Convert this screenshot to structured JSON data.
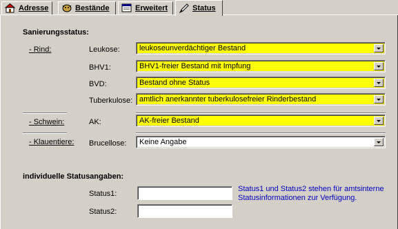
{
  "tabs": [
    {
      "label": "Adresse",
      "icon": "house-icon"
    },
    {
      "label": "Bestände",
      "icon": "cow-icon"
    },
    {
      "label": "Erweitert",
      "icon": "window-icon"
    },
    {
      "label": "Status",
      "icon": "pen-icon",
      "active": true
    }
  ],
  "sanierung": {
    "heading": "Sanierungsstatus:",
    "rind": {
      "category": "- Rind:",
      "leukose_label": "Leukose:",
      "leukose_value": "leukoseunverdächtiger Bestand",
      "bhv1_label": "BHV1:",
      "bhv1_value": "BHV1-freier Bestand mit Impfung",
      "bvd_label": "BVD:",
      "bvd_value": "Bestand ohne Status",
      "tb_label": "Tuberkulose:",
      "tb_value": "amtlich anerkannter tuberkulosefreier Rinderbestand"
    },
    "schwein": {
      "category": "- Schwein:",
      "ak_label": "AK:",
      "ak_value": "AK-freier Bestand"
    },
    "klauentiere": {
      "category": "- Klauentiere:",
      "brucellose_label": "Brucellose:",
      "brucellose_value": "Keine Angabe"
    }
  },
  "individual": {
    "heading": "individuelle Statusangaben:",
    "status1_label": "Status1:",
    "status1_value": "",
    "status2_label": "Status2:",
    "status2_value": "",
    "info_line1": "Status1 und Status2 stehen für amtsinterne",
    "info_line2": "Statusinformationen zur Verfügung."
  },
  "colors": {
    "highlight": "#ffff00",
    "info_text": "#0000c0",
    "background": "#d4d0c8"
  }
}
